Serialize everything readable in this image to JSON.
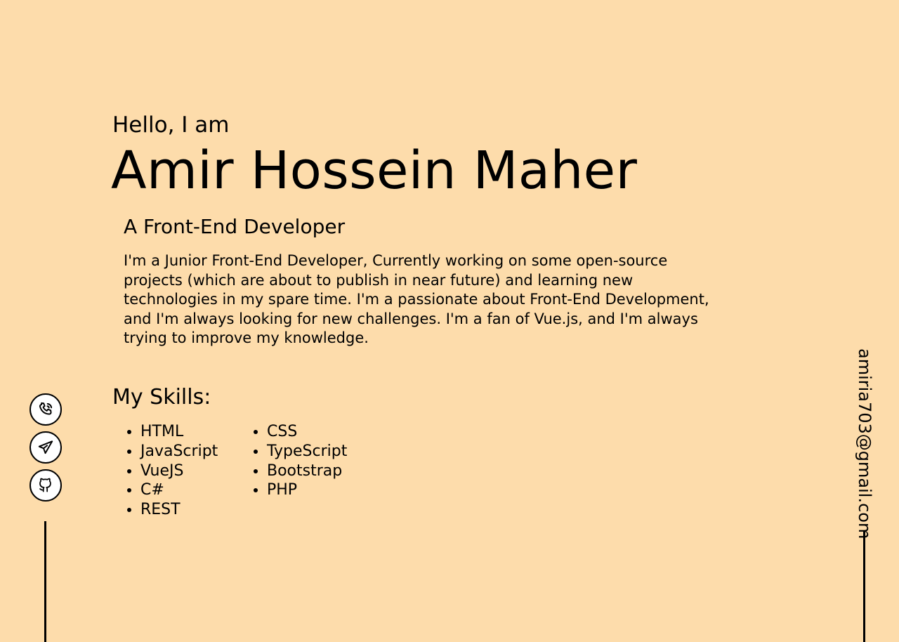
{
  "hero": {
    "greeting": "Hello, I am",
    "name": "Amir Hossein Maher",
    "subtitle": "A Front-End Developer",
    "bio": "I'm a Junior Front-End Developer, Currently working on some open-source projects (which are about to publish in near future) and learning new technologies in my spare time. I'm a passionate about Front-End Development, and I'm always looking for new challenges. I'm a fan of Vue.js, and I'm always trying to improve my knowledge."
  },
  "skills": {
    "heading": "My Skills:",
    "items": [
      "HTML",
      "JavaScript",
      "VueJS",
      "C#",
      "REST",
      "CSS",
      "TypeScript",
      "Bootstrap",
      "PHP"
    ]
  },
  "socials": [
    {
      "icon": "phone-icon"
    },
    {
      "icon": "telegram-icon"
    },
    {
      "icon": "github-icon"
    }
  ],
  "contact": {
    "email": "amiria703@gmail.com"
  },
  "colors": {
    "background": "#fddcab",
    "text": "#000000",
    "icon_background": "#ffffff"
  }
}
